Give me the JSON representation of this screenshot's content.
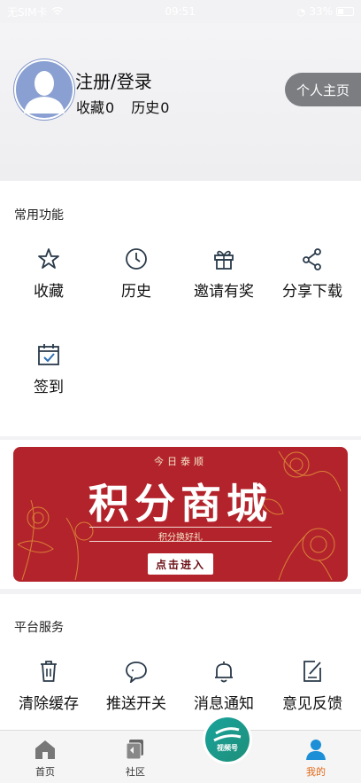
{
  "status_bar": {
    "carrier": "无SIM卡",
    "time": "09:51",
    "battery": "33%"
  },
  "profile": {
    "login_text": "注册/登录",
    "favorites_label": "收藏",
    "favorites_count": "0",
    "history_label": "历史",
    "history_count": "0",
    "home_button": "个人主页"
  },
  "common": {
    "title": "常用功能",
    "items": [
      {
        "label": "收藏",
        "icon": "star-icon"
      },
      {
        "label": "历史",
        "icon": "clock-icon"
      },
      {
        "label": "邀请有奖",
        "icon": "gift-icon"
      },
      {
        "label": "分享下载",
        "icon": "share-icon"
      },
      {
        "label": "签到",
        "icon": "calendar-check-icon"
      }
    ]
  },
  "banner": {
    "top_text": "今日泰顺",
    "title": "积分商城",
    "subtitle": "积分换好礼",
    "button": "点击进入"
  },
  "platform": {
    "title": "平台服务",
    "items": [
      {
        "label": "清除缓存",
        "icon": "trash-icon"
      },
      {
        "label": "推送开关",
        "icon": "chat-bubble-icon"
      },
      {
        "label": "消息通知",
        "icon": "bell-icon"
      },
      {
        "label": "意见反馈",
        "icon": "edit-icon"
      }
    ]
  },
  "tabbar": {
    "home": "首页",
    "community": "社区",
    "video": "视频号",
    "mine": "我的",
    "active_color": "#e26a1a"
  }
}
